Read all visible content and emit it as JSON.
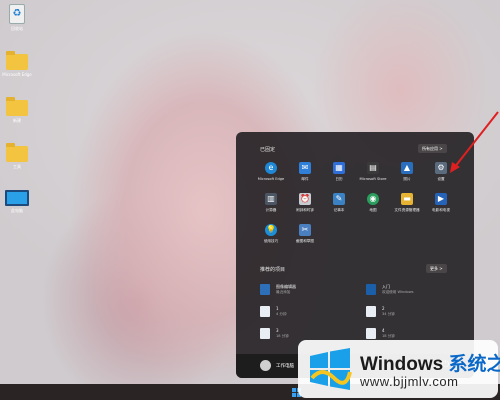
{
  "desktop": {
    "icons": [
      {
        "label": "回收站",
        "icon": "recycle-bin-icon"
      },
      {
        "label": "Microsoft Edge",
        "icon": "folder-icon"
      },
      {
        "label": "新建",
        "icon": "folder-icon"
      },
      {
        "label": "工具",
        "icon": "folder-icon"
      },
      {
        "label": "此电脑",
        "icon": "monitor-icon"
      }
    ]
  },
  "start_menu": {
    "pinned_title": "已固定",
    "all_apps_label": "所有应用 >",
    "pinned_apps": [
      {
        "label": "Microsoft Edge",
        "icon": "edge-icon",
        "color": "#1e88d6"
      },
      {
        "label": "邮件",
        "icon": "mail-icon",
        "color": "#2f7fd8"
      },
      {
        "label": "日历",
        "icon": "calendar-icon",
        "color": "#2f6ed8"
      },
      {
        "label": "Microsoft Store",
        "icon": "store-icon",
        "color": "#3a3a3a"
      },
      {
        "label": "照片",
        "icon": "photos-icon",
        "color": "#2a6fbf"
      },
      {
        "label": "设置",
        "icon": "gear-icon",
        "color": "#5a6b7d"
      },
      {
        "label": "计算器",
        "icon": "calculator-icon",
        "color": "#4b5563"
      },
      {
        "label": "闹钟和时钟",
        "icon": "clock-icon",
        "color": "#c9cdd3"
      },
      {
        "label": "记事本",
        "icon": "notepad-icon",
        "color": "#3b82c4"
      },
      {
        "label": "地图",
        "icon": "map-icon",
        "color": "#2a9e5c"
      },
      {
        "label": "文件资源管理器",
        "icon": "folder-icon",
        "color": "#e6b432"
      },
      {
        "label": "电影和电视",
        "icon": "movies-icon",
        "color": "#2563b8"
      },
      {
        "label": "使用技巧",
        "icon": "tips-icon",
        "color": "#1d8fd8"
      },
      {
        "label": "截图和草图",
        "icon": "snip-icon",
        "color": "#4a7fc0"
      }
    ],
    "recommended_title": "推荐的项目",
    "more_label": "更多 >",
    "recommended": [
      {
        "name": "图像编辑器",
        "sub": "最近添加",
        "icon": "image-editor-icon"
      },
      {
        "name": "入门",
        "sub": "欢迎使用 Windows",
        "icon": "get-started-icon"
      },
      {
        "name": "1",
        "sub": "4 分钟",
        "icon": "file-icon"
      },
      {
        "name": "2",
        "sub": "34 分钟",
        "icon": "file-icon"
      },
      {
        "name": "3",
        "sub": "18 分钟",
        "icon": "file-icon"
      },
      {
        "name": "4",
        "sub": "18 分钟",
        "icon": "file-icon"
      }
    ],
    "user_name": "工作电脑",
    "power_icon": "power-icon"
  },
  "watermark": {
    "brand_main": "Windows",
    "brand_cn": "系统之家",
    "url": "www.bjjmlv.com"
  },
  "colors": {
    "accent_blue": "#0a68c9",
    "arrow_red": "#e02020",
    "menu_bg": "#282528"
  }
}
